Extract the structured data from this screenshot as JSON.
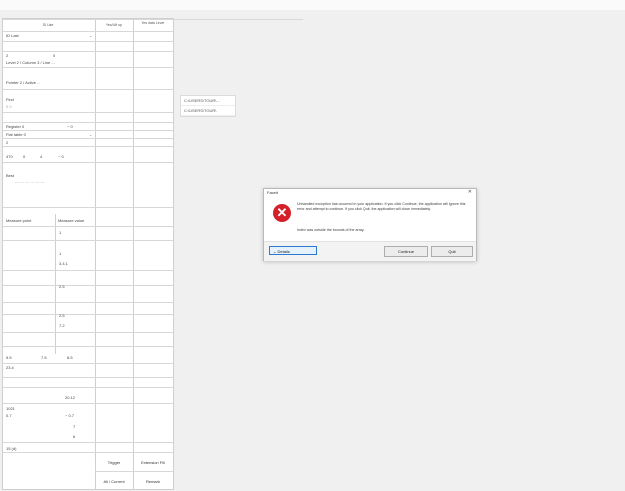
{
  "dialog": {
    "title": "Faceit",
    "close_glyph": "✕",
    "icon_glyph": "✕",
    "message": "Unhandled exception has occurred in your application. If you click Continue, the application will ignore this error and attempt to continue. If you click Quit, the application will close immediately.",
    "detail": "Index was outside the bounds of the array.",
    "details_label": "Details",
    "continue_label": "Continue",
    "quit_label": "Quit",
    "colors": {
      "error_icon": "#d4202a",
      "focus_border": "#2a7ad5"
    }
  },
  "paths": [
    "C:\\USERS\\TOUR\\...",
    "C:\\USERS\\TOUR\\"
  ],
  "form": {
    "headers": [
      "ID Use",
      "Yes/Lift up",
      "Yes data Lever"
    ],
    "r1": "ID Last",
    "r2a": "2",
    "r2b": "0",
    "r3": "Level 2 / Column 3 / Line ...",
    "r4": "Pointer 2 / Active ...",
    "r5": "Find",
    "r5b": "0 0",
    "r6a": "Register 0",
    "r6b": "~ 0",
    "r7": "Flat table 0",
    "r8": "2",
    "r9a": "470",
    "r9b": "0",
    "r9c": "4",
    "r9d": "~ 0",
    "r10": "Best",
    "r10b": "— — — — — —",
    "col_a": "Measure point",
    "col_b": "Measure value",
    "v1": "1",
    "v2": "1",
    "v3": "3.4.1",
    "v4": "2.5",
    "v5": "2.5",
    "v6": "7.2",
    "t1a": "5.5",
    "t1b": "7.5",
    "t1c": "8.5",
    "t2": "23.4",
    "t3": "20.12",
    "t4": "1021",
    "t5a": "0.7",
    "t5b": "~ 0.7",
    "t6": "7",
    "t7": "6",
    "t8": "15 (d)",
    "b1": "Trigger",
    "b2": "Extension Fill",
    "b3": "All / Current",
    "b4": "Remark"
  }
}
